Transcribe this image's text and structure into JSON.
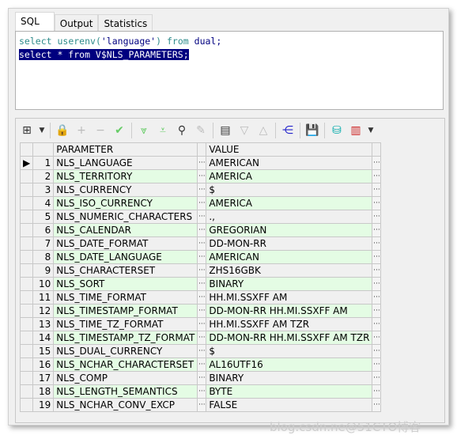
{
  "tabs": [
    "SQL",
    "Output",
    "Statistics"
  ],
  "editor": {
    "line1": {
      "k1": "select",
      "fn": "userenv(",
      "str": "'language'",
      "close": ")",
      "k2": "from",
      "rest": "dual;"
    },
    "line2": "select * from V$NLS_PARAMETERS;"
  },
  "toolbar": [
    "grid-layout-icon",
    "dropdown-icon",
    "lock-icon",
    "add-icon",
    "remove-icon",
    "post-icon",
    "next-record-icon",
    "last-record-icon",
    "find-icon",
    "clear-icon",
    "query-by-example-icon",
    "filter-down-icon",
    "filter-up-icon",
    "hierarchy-icon",
    "save-icon",
    "export-icon",
    "chart-icon",
    "dropdown-icon"
  ],
  "grid": {
    "headers": [
      "PARAMETER",
      "VALUE"
    ],
    "rows": [
      [
        "1",
        "NLS_LANGUAGE",
        "AMERICAN"
      ],
      [
        "2",
        "NLS_TERRITORY",
        "AMERICA"
      ],
      [
        "3",
        "NLS_CURRENCY",
        "$"
      ],
      [
        "4",
        "NLS_ISO_CURRENCY",
        "AMERICA"
      ],
      [
        "5",
        "NLS_NUMERIC_CHARACTERS",
        ".,"
      ],
      [
        "6",
        "NLS_CALENDAR",
        "GREGORIAN"
      ],
      [
        "7",
        "NLS_DATE_FORMAT",
        "DD-MON-RR"
      ],
      [
        "8",
        "NLS_DATE_LANGUAGE",
        "AMERICAN"
      ],
      [
        "9",
        "NLS_CHARACTERSET",
        "ZHS16GBK"
      ],
      [
        "10",
        "NLS_SORT",
        "BINARY"
      ],
      [
        "11",
        "NLS_TIME_FORMAT",
        "HH.MI.SSXFF AM"
      ],
      [
        "12",
        "NLS_TIMESTAMP_FORMAT",
        "DD-MON-RR HH.MI.SSXFF AM"
      ],
      [
        "13",
        "NLS_TIME_TZ_FORMAT",
        "HH.MI.SSXFF AM TZR"
      ],
      [
        "14",
        "NLS_TIMESTAMP_TZ_FORMAT",
        "DD-MON-RR HH.MI.SSXFF AM TZR"
      ],
      [
        "15",
        "NLS_DUAL_CURRENCY",
        "$"
      ],
      [
        "16",
        "NLS_NCHAR_CHARACTERSET",
        "AL16UTF16"
      ],
      [
        "17",
        "NLS_COMP",
        "BINARY"
      ],
      [
        "18",
        "NLS_LENGTH_SEMANTICS",
        "BYTE"
      ],
      [
        "19",
        "NLS_NCHAR_CONV_EXCP",
        "FALSE"
      ]
    ]
  },
  "dots": "···",
  "watermark": "blog.csdn.ne@51CTO博客"
}
